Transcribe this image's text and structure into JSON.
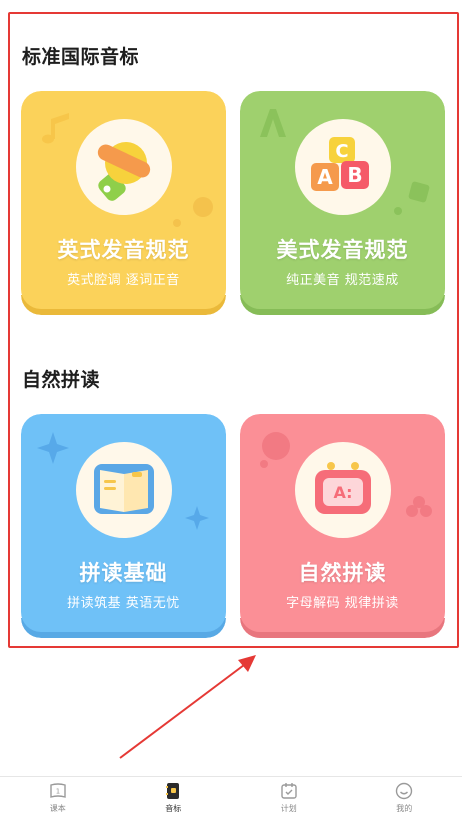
{
  "sections": [
    {
      "title": "标准国际音标",
      "cards": [
        {
          "title": "英式发音规范",
          "subtitle": "英式腔调 逐词正音",
          "icon": "whistle-icon"
        },
        {
          "title": "美式发音规范",
          "subtitle": "纯正美音 规范速成",
          "icon": "abc-blocks-icon"
        }
      ]
    },
    {
      "title": "自然拼读",
      "cards": [
        {
          "title": "拼读基础",
          "subtitle": "拼读筑基 英语无忧",
          "icon": "open-book-icon"
        },
        {
          "title": "自然拼读",
          "subtitle": "字母解码 规律拼读",
          "icon": "tv-robot-icon"
        }
      ]
    }
  ],
  "tabbar": {
    "tabs": [
      {
        "label": "课本",
        "icon": "textbook-icon",
        "active": false
      },
      {
        "label": "音标",
        "icon": "phonetic-book-icon",
        "active": true
      },
      {
        "label": "计划",
        "icon": "calendar-check-icon",
        "active": false
      },
      {
        "label": "我的",
        "icon": "smiley-face-icon",
        "active": false
      }
    ]
  },
  "colors": {
    "highlight": "#e53935",
    "yellow_card": "#fbd25a",
    "green_card": "#9fd06e",
    "blue_card": "#6fc1f7",
    "pink_card": "#fb8f96"
  }
}
